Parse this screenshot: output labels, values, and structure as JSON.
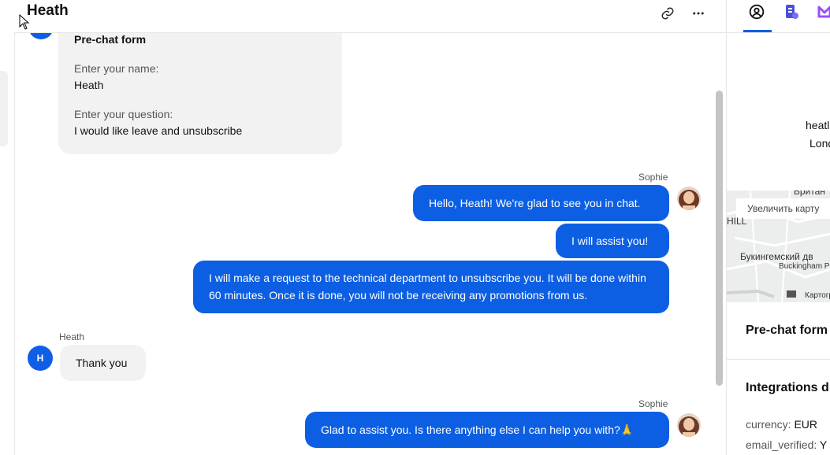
{
  "header": {
    "title": "Heath",
    "link_icon": "link-icon",
    "more_icon": "more-horizontal-icon"
  },
  "form_card": {
    "title": "Pre-chat form",
    "name_label": "Enter your name:",
    "name_value": "Heath",
    "question_label": "Enter your question:",
    "question_value": "I would like leave and unsubscribe"
  },
  "messages": [
    {
      "sender": "Sophie",
      "text": "Hello, Heath! We're glad to see you in chat."
    },
    {
      "sender": "Sophie",
      "text": "I will assist you!"
    },
    {
      "sender": "Sophie",
      "text": "I will make a request to the technical department to unsubscribe you. It will be done within 60 minutes. Once it is done, you will not be receiving any promotions from us."
    },
    {
      "sender": "Heath",
      "avatar_initial": "H",
      "text": "Thank you"
    },
    {
      "sender": "Sophie",
      "text": "Glad to assist you. Is there anything else I can help you with?🙏"
    }
  ],
  "right_panel": {
    "tabs": [
      "user-circle-icon",
      "contact-card-icon",
      "purple-app-icon"
    ],
    "email_partial": "heatl",
    "location_partial": "Lond",
    "map": {
      "zoom_label": "Увеличить карту",
      "label_top": "Британ",
      "label_hill": "HILL",
      "label_palace_ru": "Букингемский дв",
      "label_palace_en": "Buckingham P",
      "label_footer": "Картогр"
    },
    "prechat_title": "Pre-chat form",
    "integrations_title": "Integrations d",
    "integrations": [
      {
        "key": "currency:",
        "value": "EUR"
      },
      {
        "key": "email_verified:",
        "value": "Y"
      }
    ]
  },
  "colors": {
    "accent": "#0c5fe3",
    "bubble_in": "#f2f2f2"
  }
}
